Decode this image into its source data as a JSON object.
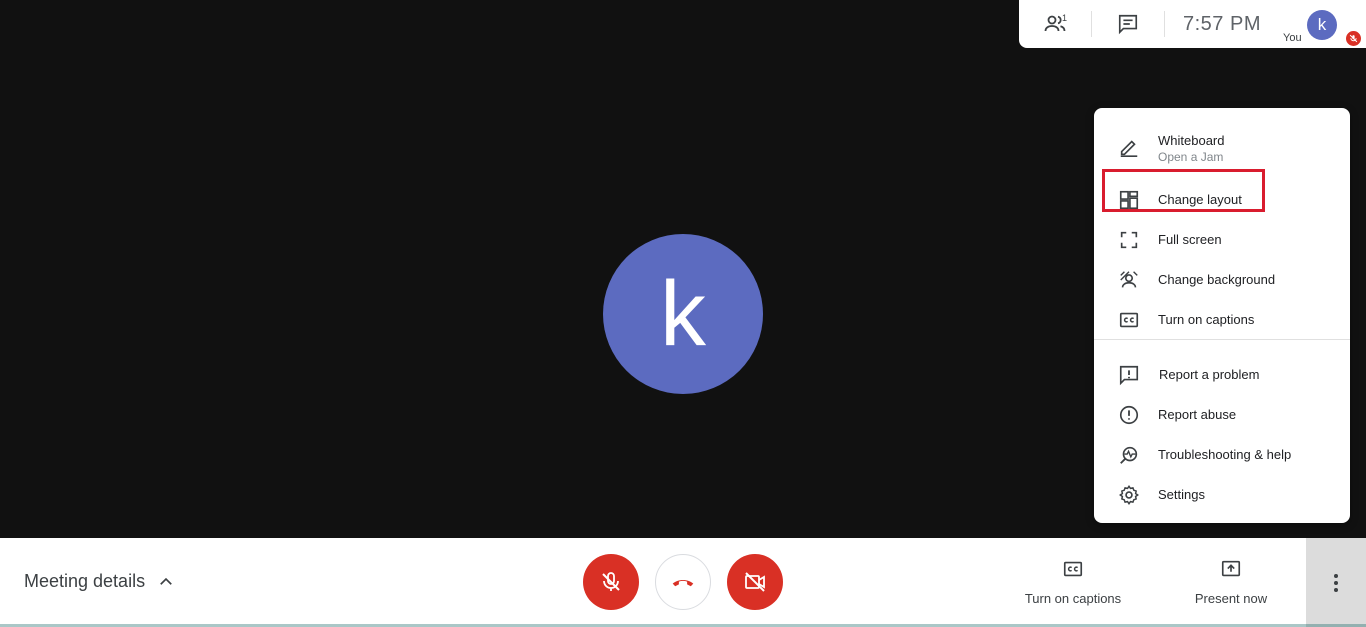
{
  "participant": {
    "initial": "k"
  },
  "topbar": {
    "people_count": "1",
    "clock": "7:57  PM",
    "self": {
      "initial": "k",
      "label": "You"
    }
  },
  "menu": {
    "items": [
      {
        "label": "Whiteboard",
        "sublabel": "Open a Jam",
        "icon": "pencil-icon"
      },
      {
        "label": "Change layout",
        "icon": "layout-icon"
      },
      {
        "label": "Full screen",
        "icon": "fullscreen-icon"
      },
      {
        "label": "Change background",
        "icon": "background-icon"
      },
      {
        "label": "Turn on captions",
        "icon": "captions-icon"
      },
      {
        "label": "Report a problem",
        "icon": "feedback-icon"
      },
      {
        "label": "Report abuse",
        "icon": "alert-icon"
      },
      {
        "label": "Troubleshooting & help",
        "icon": "troubleshoot-icon"
      },
      {
        "label": "Settings",
        "icon": "gear-icon"
      }
    ]
  },
  "bottombar": {
    "meeting_details": "Meeting details",
    "captions_label": "Turn on captions",
    "present_label": "Present now"
  },
  "colors": {
    "accent_avatar": "#5c6bc0",
    "danger": "#d93025",
    "highlight": "#d91c2e"
  }
}
